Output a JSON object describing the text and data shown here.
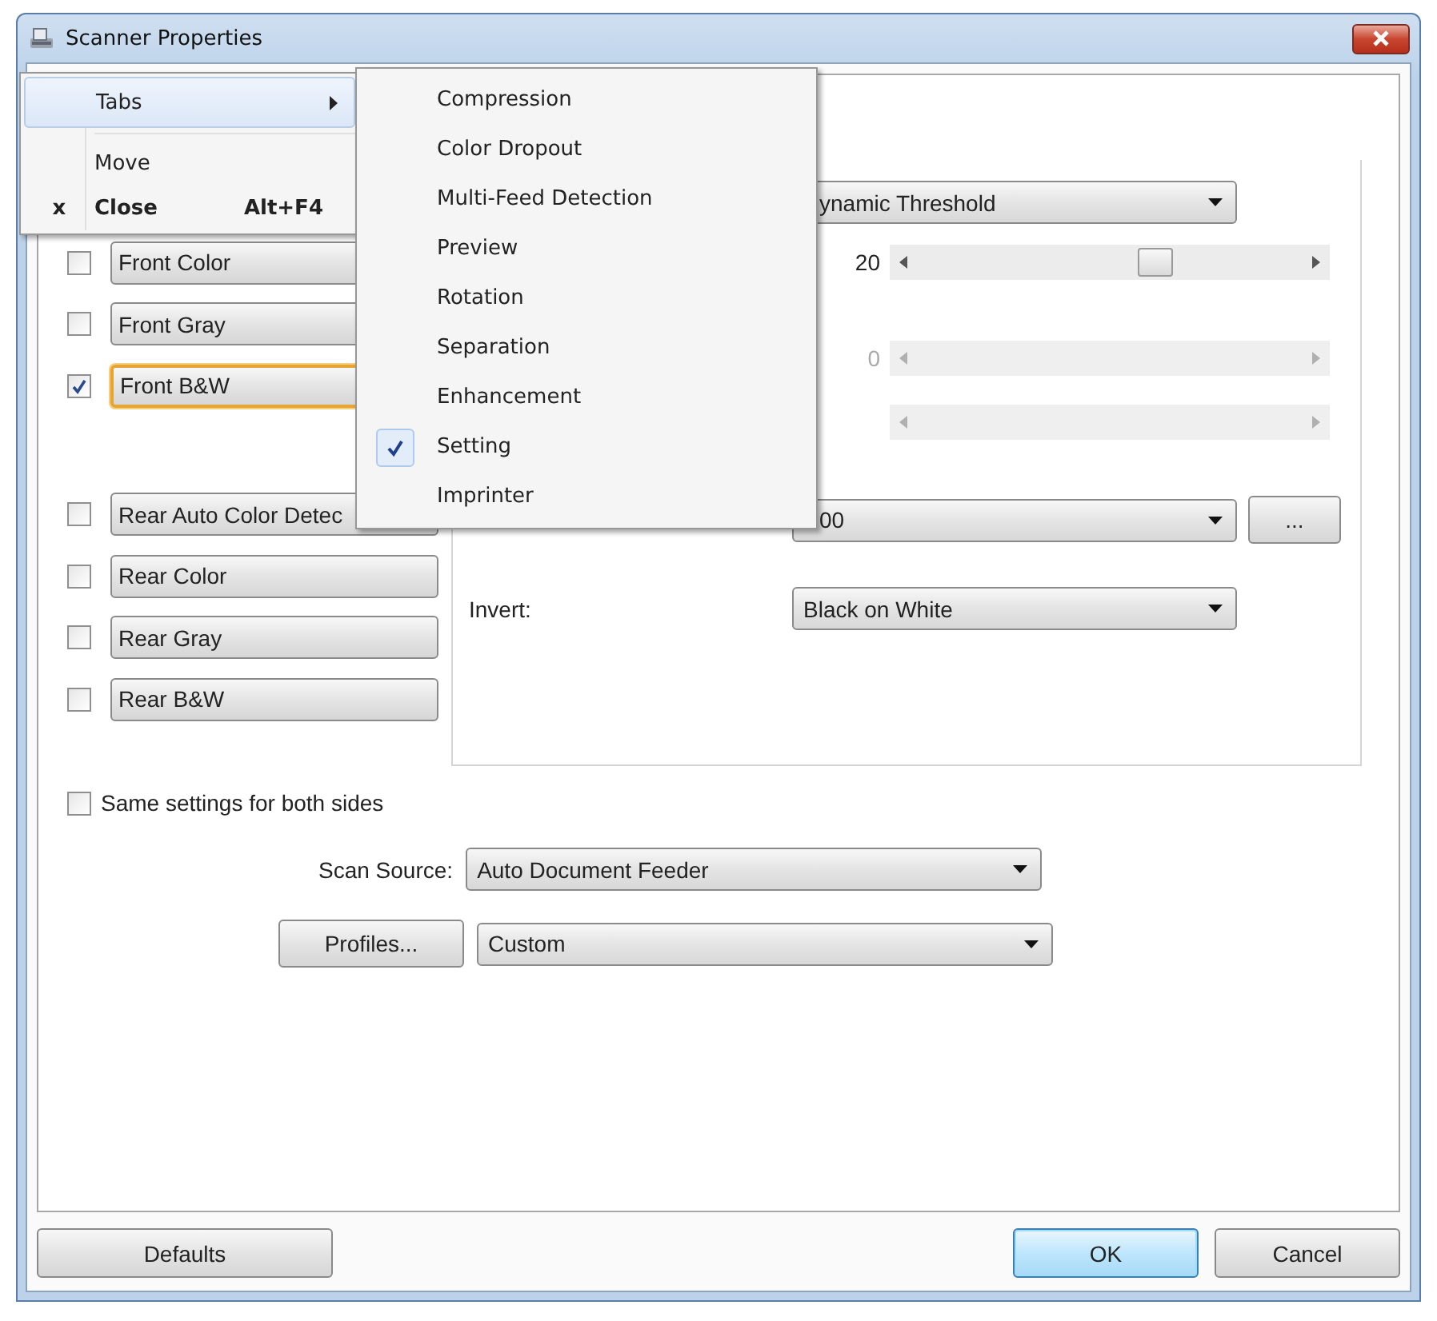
{
  "window": {
    "title": "Scanner Properties"
  },
  "system_menu": {
    "items": [
      {
        "label": "Tabs",
        "kind": "submenu",
        "selected": true,
        "default": false
      },
      {
        "label": "Move",
        "kind": "item",
        "selected": false,
        "default": false
      },
      {
        "label": "Close",
        "kind": "item",
        "selected": false,
        "default": true,
        "glyph": "x",
        "shortcut": "Alt+F4"
      }
    ]
  },
  "tabs_submenu": {
    "items": [
      {
        "label": "Compression",
        "checked": false
      },
      {
        "label": "Color Dropout",
        "checked": false
      },
      {
        "label": "Multi-Feed Detection",
        "checked": false
      },
      {
        "label": "Preview",
        "checked": false
      },
      {
        "label": "Rotation",
        "checked": false
      },
      {
        "label": "Separation",
        "checked": false
      },
      {
        "label": "Enhancement",
        "checked": false
      },
      {
        "label": "Setting",
        "checked": true
      },
      {
        "label": "Imprinter",
        "checked": false
      }
    ]
  },
  "image_types": [
    {
      "label": "Front Color",
      "checked": false,
      "focused": false
    },
    {
      "label": "Front Gray",
      "checked": false,
      "focused": false
    },
    {
      "label": "Front B&W",
      "checked": true,
      "focused": true
    },
    {
      "label": "Rear Auto Color Detec",
      "checked": false,
      "focused": false
    },
    {
      "label": "Rear Color",
      "checked": false,
      "focused": false
    },
    {
      "label": "Rear Gray",
      "checked": false,
      "focused": false
    },
    {
      "label": "Rear B&W",
      "checked": false,
      "focused": false
    }
  ],
  "settings": {
    "threshold_dropdown": "ynamic Threshold",
    "sliders": [
      {
        "reading": "20",
        "level": 0.63,
        "disabled": false
      },
      {
        "reading": "0",
        "disabled": true
      },
      {
        "disabled": true
      }
    ],
    "resolution_dropdown": "00",
    "more_button": "...",
    "invert": {
      "label": "Invert:",
      "value": "Black on White"
    }
  },
  "same_settings": {
    "label": "Same settings for both sides",
    "checked": false
  },
  "scan_source": {
    "label": "Scan Source:",
    "value": "Auto Document Feeder"
  },
  "profiles": {
    "button": "Profiles...",
    "value": "Custom"
  },
  "buttons": [
    {
      "label": "Defaults",
      "default": false
    },
    {
      "label": "OK",
      "default": true
    },
    {
      "label": "Cancel",
      "default": false
    }
  ]
}
